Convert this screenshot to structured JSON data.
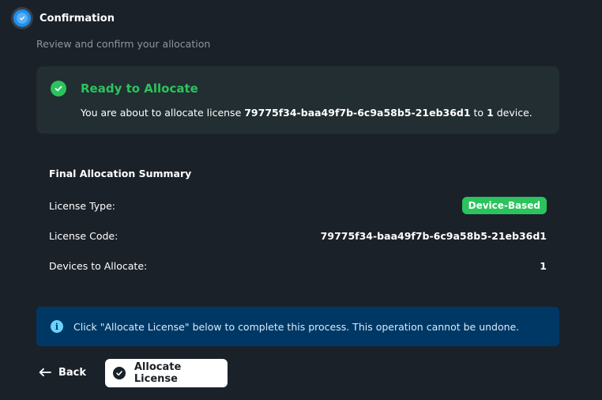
{
  "step": {
    "title": "Confirmation",
    "subtitle": "Review and confirm your allocation",
    "icon": "check-circle-icon",
    "color": "#1e8ff0"
  },
  "ready": {
    "title": "Ready to Allocate",
    "text_prefix": "You are about to allocate license ",
    "license_code": "79775f34-baa49f7b-6c9a58b5-21eb36d1",
    "text_middle": " to ",
    "device_count": "1",
    "text_suffix": " device.",
    "color": "#2bc35d"
  },
  "summary": {
    "title": "Final Allocation Summary",
    "rows": [
      {
        "label": "License Type:",
        "value": "Device-Based"
      },
      {
        "label": "License Code:",
        "value": "79775f34-baa49f7b-6c9a58b5-21eb36d1"
      },
      {
        "label": "Devices to Allocate:",
        "value": "1"
      }
    ]
  },
  "info": {
    "text": "Click \"Allocate License\" below to complete this process. This operation cannot be undone.",
    "icon": "info-icon",
    "background": "#003865"
  },
  "actions": {
    "back_label": "Back",
    "allocate_label": "Allocate License"
  }
}
